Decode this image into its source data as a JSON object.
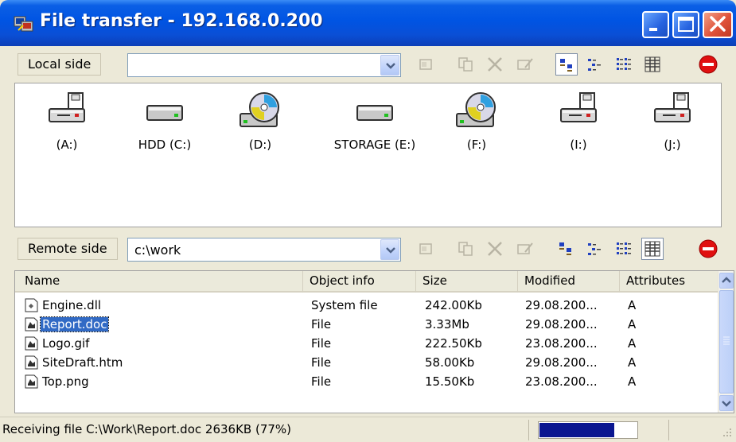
{
  "window": {
    "title": "File transfer - 192.168.0.200",
    "accent": "#0054e3"
  },
  "local_side": {
    "label": "Local side",
    "path": "",
    "drives": [
      {
        "label": "(A:)",
        "icon": "floppy-drive-icon"
      },
      {
        "label": "HDD (C:)",
        "icon": "hard-drive-icon"
      },
      {
        "label": "(D:)",
        "icon": "cd-drive-icon"
      },
      {
        "label": "STORAGE (E:)",
        "icon": "hard-drive-icon"
      },
      {
        "label": "(F:)",
        "icon": "cd-drive-icon"
      },
      {
        "label": "(I:)",
        "icon": "floppy-drive-icon"
      },
      {
        "label": "(J:)",
        "icon": "floppy-drive-icon"
      }
    ]
  },
  "remote_side": {
    "label": "Remote side",
    "path": "c:\\work",
    "columns": [
      "Name",
      "Object info",
      "Size",
      "Modified",
      "Attributes"
    ],
    "files": [
      {
        "name": "Engine.dll",
        "info": "System file",
        "size": "242.00Kb",
        "modified": "29.08.200...",
        "attr": "A",
        "selected": false
      },
      {
        "name": "Report.doc",
        "info": "File",
        "size": "3.33Mb",
        "modified": "29.08.200...",
        "attr": "A",
        "selected": true
      },
      {
        "name": "Logo.gif",
        "info": "File",
        "size": "222.50Kb",
        "modified": "23.08.200...",
        "attr": "A",
        "selected": false
      },
      {
        "name": "SiteDraft.htm",
        "info": "File",
        "size": "58.00Kb",
        "modified": "29.08.200...",
        "attr": "A",
        "selected": false
      },
      {
        "name": "Top.png",
        "info": "File",
        "size": "15.50Kb",
        "modified": "23.08.200...",
        "attr": "A",
        "selected": false
      }
    ]
  },
  "status": {
    "text": "Receiving file C:\\Work\\Report.doc 2636KB (77%)",
    "progress_percent": 77,
    "progress_color": "#0a1690"
  }
}
